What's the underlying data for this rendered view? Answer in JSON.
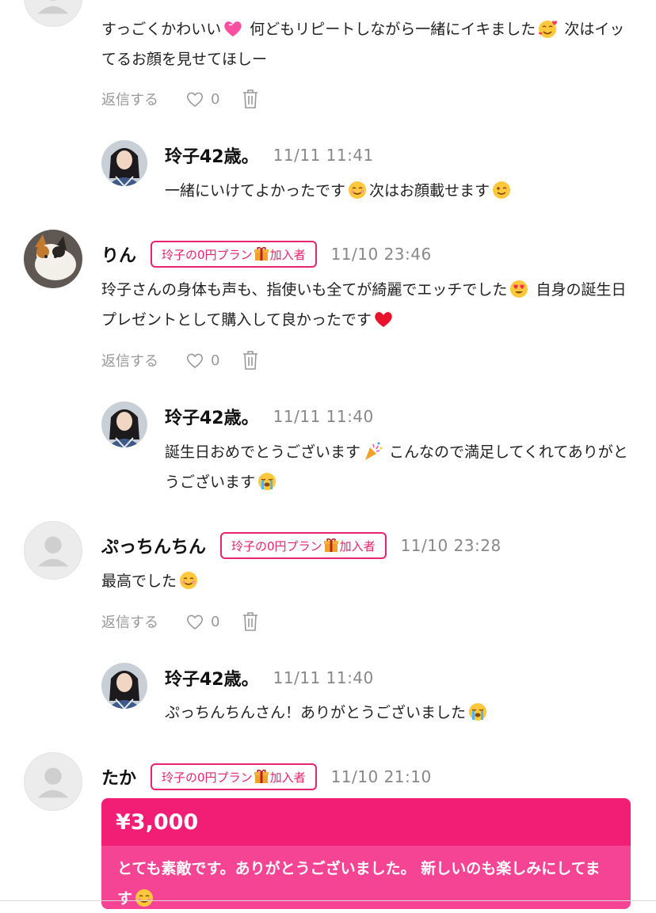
{
  "colors": {
    "accent": "#e8236f",
    "tip_amount_bg": "#f21e76",
    "tip_msg_bg": "#f64494",
    "muted": "#888888"
  },
  "badge": {
    "prefix": "玲子の0円プラン",
    "suffix": "加入者",
    "icon": "gift-icon"
  },
  "actions": {
    "reply": "返信する",
    "like_count": "0"
  },
  "comments": [
    {
      "body": {
        "part1": "すっごくかわいい",
        "part2": " 何どもリピートしながら一緒にイキました",
        "part3": " 次はイッてるお顔を見せてほしー"
      },
      "reply": {
        "name": "玲子42歳。",
        "time": "11/11 11:41",
        "body": {
          "part1": "一緒にいけてよかったです",
          "part2": "次はお顔載せます"
        }
      }
    },
    {
      "name": "りん",
      "time": "11/10 23:46",
      "body": {
        "part1": "玲子さんの身体も声も、指使いも全てが綺麗でエッチでした",
        "part2": " 自身の誕生日プレゼントとして購入して良かったです"
      },
      "reply": {
        "name": "玲子42歳。",
        "time": "11/11 11:40",
        "body": {
          "part1": "誕生日おめでとうございます",
          "part2": " こんなので満足してくれてありがとうございます"
        }
      }
    },
    {
      "name": "ぷっちんちん",
      "time": "11/10 23:28",
      "body": {
        "part1": "最高でした"
      },
      "reply": {
        "name": "玲子42歳。",
        "time": "11/11 11:40",
        "body": {
          "part1": "ぷっちんちんさん！ありがとうございました"
        }
      }
    },
    {
      "name": "たか",
      "time": "11/10 21:10",
      "tip": {
        "amount": "¥3,000",
        "message": "とても素敵です。ありがとうございました。 新しいのも楽しみにしてます"
      }
    }
  ]
}
